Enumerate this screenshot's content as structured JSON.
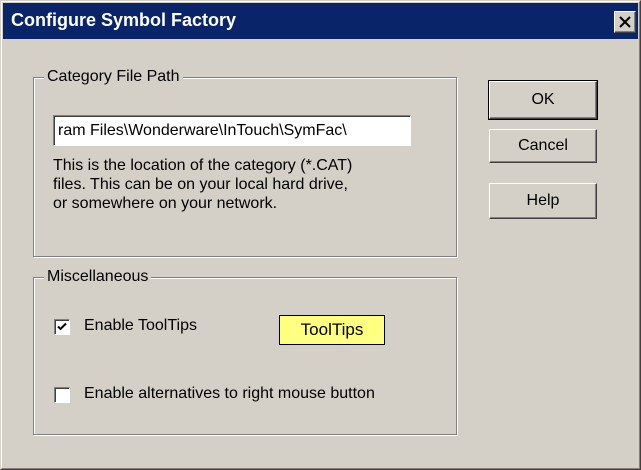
{
  "window": {
    "title": "Configure Symbol Factory",
    "close_label": "Close"
  },
  "category_group": {
    "legend": "Category File Path",
    "path_value": "ram Files\\Wonderware\\InTouch\\SymFac\\",
    "description": [
      "This is the location of the category (*.CAT)",
      "files.  This can be on your local hard drive,",
      "or somewhere on your network."
    ]
  },
  "misc_group": {
    "legend": "Miscellaneous",
    "enable_tooltips": {
      "label": "Enable ToolTips",
      "checked": true
    },
    "tooltip_sample": "ToolTips",
    "enable_alternatives": {
      "label": "Enable alternatives to right mouse button",
      "checked": false
    }
  },
  "buttons": {
    "ok": "OK",
    "cancel": "Cancel",
    "help": "Help"
  },
  "colors": {
    "title_bar": "#0a246a",
    "dialog_face": "#d4d0c8",
    "tooltip_bg": "#ffff80"
  }
}
